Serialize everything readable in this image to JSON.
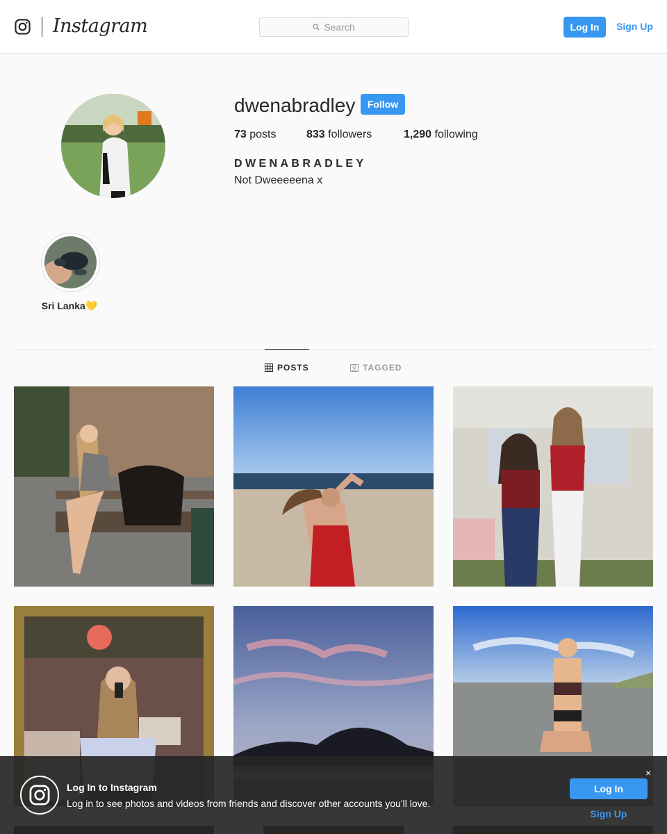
{
  "header": {
    "wordmark": "Instagram",
    "search_placeholder": "Search",
    "login_label": "Log In",
    "signup_label": "Sign Up"
  },
  "profile": {
    "username": "dwenabradley",
    "follow_label": "Follow",
    "posts_count": "73",
    "posts_label": " posts",
    "followers_count": "833",
    "followers_label": " followers",
    "following_count": "1,290",
    "following_label": " following",
    "full_name": "DWENABRADLEY",
    "bio": "Not Dweeeeena x"
  },
  "highlights": [
    {
      "label": "Sri Lanka💛"
    }
  ],
  "tabs": [
    {
      "label": "POSTS",
      "active": true
    },
    {
      "label": "TAGGED",
      "active": false
    }
  ],
  "banner": {
    "title": "Log In to Instagram",
    "text": "Log in to see photos and videos from friends and discover other accounts you'll love.",
    "close": "×",
    "login_label": "Log In",
    "signup_label": "Sign Up"
  },
  "colors": {
    "accent": "#3897f0",
    "text": "#262626",
    "border": "#dbdbdb",
    "background": "#fafafa"
  }
}
